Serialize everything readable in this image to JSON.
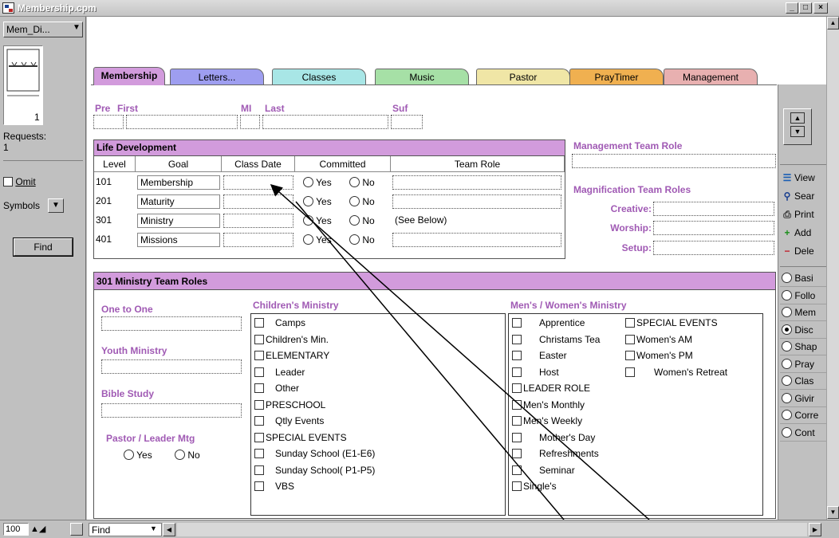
{
  "window": {
    "title": "Membership.cpm",
    "min": "_",
    "max": "□",
    "close": "×"
  },
  "left": {
    "layout_select": "Mem_Di...",
    "record_number": "1",
    "requests_label": "Requests:",
    "requests_value": "1",
    "omit_label": "Omit",
    "symbols_label": "Symbols",
    "find_button": "Find"
  },
  "tabs": [
    {
      "label": "Membership",
      "color": "#d29bdc"
    },
    {
      "label": "Letters...",
      "color": "#9e9ef0"
    },
    {
      "label": "Classes",
      "color": "#a8e6e6"
    },
    {
      "label": "Music",
      "color": "#a6e0a6"
    },
    {
      "label": "Pastor",
      "color": "#f0e6a6"
    },
    {
      "label": "PrayTimer",
      "color": "#f0b050"
    },
    {
      "label": "Management",
      "color": "#e8b0b0"
    }
  ],
  "name": {
    "pre": "Pre",
    "first": "First",
    "mi": "MI",
    "last": "Last",
    "suf": "Suf"
  },
  "life_development": {
    "title": "Life Development",
    "headers": [
      "Level",
      "Goal",
      "Class Date",
      "Committed",
      "Team Role"
    ],
    "rows": [
      {
        "level": "101",
        "goal": "Membership",
        "yes": "Yes",
        "no": "No",
        "role": ""
      },
      {
        "level": "201",
        "goal": "Maturity",
        "yes": "Yes",
        "no": "No",
        "role": ""
      },
      {
        "level": "301",
        "goal": "Ministry",
        "yes": "Yes",
        "no": "No",
        "role": "(See Below)"
      },
      {
        "level": "401",
        "goal": "Missions",
        "yes": "Yes",
        "no": "No",
        "role": ""
      }
    ]
  },
  "management_team_role": "Management Team Role",
  "magnification": {
    "title": "Magnification Team Roles",
    "creative": "Creative:",
    "worship": "Worship:",
    "setup": "Setup:"
  },
  "right_buttons": [
    "View",
    "Sear",
    "Print",
    "Add",
    "Dele"
  ],
  "right_radios": [
    {
      "label": "Basi",
      "on": false
    },
    {
      "label": "Follo",
      "on": false
    },
    {
      "label": "Mem",
      "on": false
    },
    {
      "label": "Disc",
      "on": true
    },
    {
      "label": "Shap",
      "on": false
    },
    {
      "label": "Pray",
      "on": false
    },
    {
      "label": "Clas",
      "on": false
    },
    {
      "label": "Givir",
      "on": false
    },
    {
      "label": "Corre",
      "on": false
    },
    {
      "label": "Cont",
      "on": false
    }
  ],
  "ministry": {
    "title": "301 Ministry Team Roles",
    "one_to_one": "One to One",
    "youth": "Youth Ministry",
    "bible": "Bible Study",
    "pastor_mtg": "Pastor / Leader Mtg",
    "yes": "Yes",
    "no": "No",
    "childrens_title": "Children's  Ministry",
    "childrens": [
      "Camps",
      "Children's Min.",
      "ELEMENTARY",
      "Leader",
      "Other",
      "PRESCHOOL",
      "Qtly Events",
      "SPECIAL EVENTS",
      "Sunday School (E1-E6)",
      "Sunday School( P1-P5)",
      "VBS"
    ],
    "mens_title": "Men's / Women's Ministry",
    "mens": [
      "Apprentice",
      "Christams Tea",
      "Easter",
      "Host",
      "LEADER ROLE",
      "Men's Monthly",
      "Men's Weekly",
      "Mother's Day",
      "Refreshments",
      "Seminar",
      "Single's"
    ],
    "womens": [
      "SPECIAL EVENTS",
      "Women's AM",
      "Women's PM",
      "Women's Retreat"
    ]
  },
  "bottom": {
    "zoom": "100",
    "mode": "Find"
  }
}
